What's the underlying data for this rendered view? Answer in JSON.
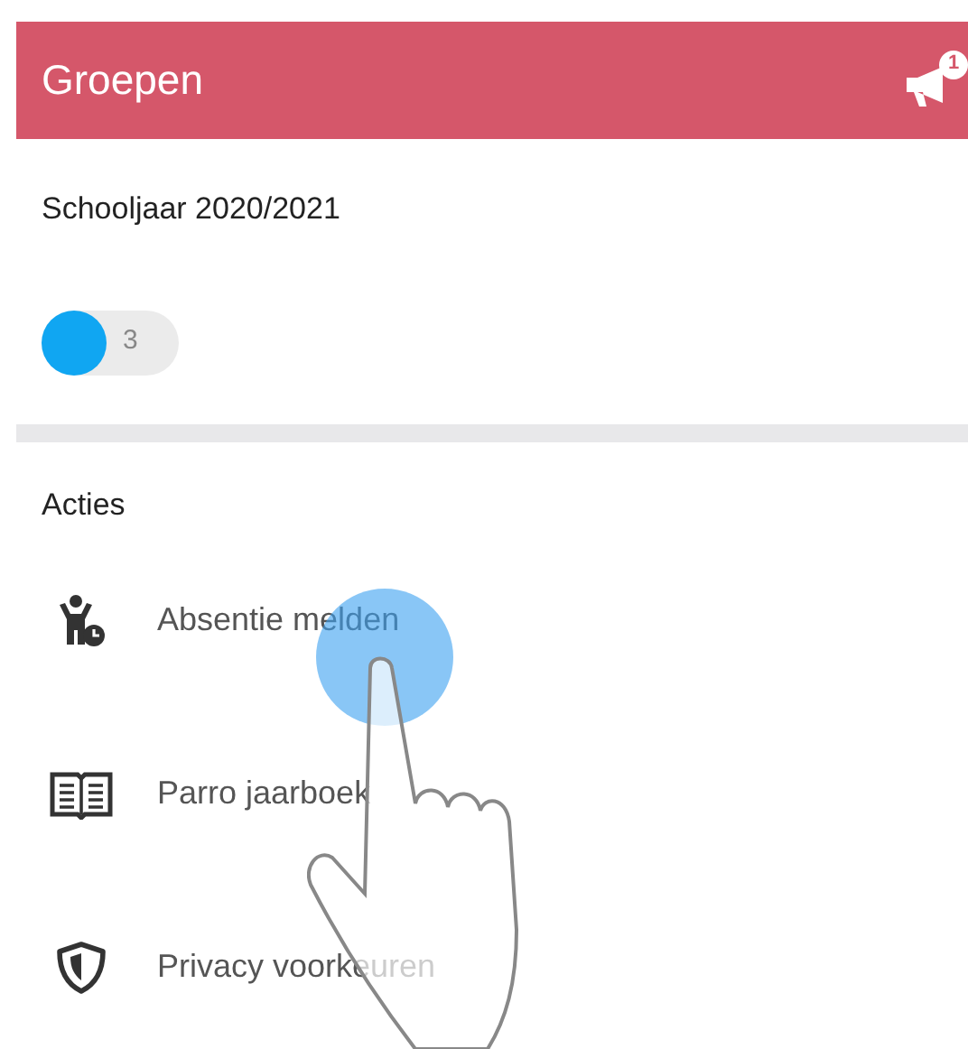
{
  "header": {
    "title": "Groepen",
    "notification_badge": "1"
  },
  "school_year": {
    "label": "Schooljaar 2020/2021",
    "group_chip": {
      "count": "3",
      "color": "#10a6f2"
    }
  },
  "actions": {
    "title": "Acties",
    "items": [
      {
        "kind": "absence",
        "label": "Absentie melden"
      },
      {
        "kind": "yearbook",
        "label": "Parro jaarboek"
      },
      {
        "kind": "privacy",
        "label": "Privacy voorkeuren"
      }
    ]
  },
  "tap_hint": {
    "kind": "hand"
  }
}
